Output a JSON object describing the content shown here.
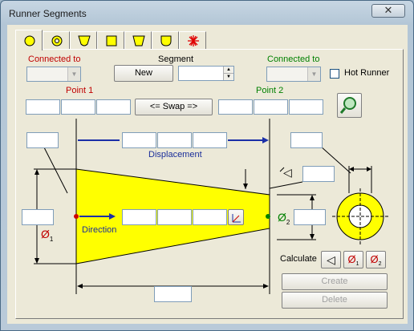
{
  "window": {
    "title": "Runner Segments",
    "close_glyph": "✕"
  },
  "tabs": [
    {
      "icon": "circle-section-icon"
    },
    {
      "icon": "annulus-section-icon"
    },
    {
      "icon": "trapezoid-rounded-section-icon"
    },
    {
      "icon": "square-section-icon"
    },
    {
      "icon": "trapezoid-section-icon"
    },
    {
      "icon": "half-round-section-icon"
    },
    {
      "icon": "custom-star-section-icon"
    }
  ],
  "connected_to_left": {
    "label": "Connected to",
    "value": ""
  },
  "segment": {
    "label": "Segment",
    "new_label": "New",
    "value": ""
  },
  "connected_to_right": {
    "label": "Connected to",
    "value": ""
  },
  "hot_runner": {
    "label": "Hot Runner",
    "checked": false
  },
  "point1": {
    "label": "Point 1",
    "values": [
      "",
      "",
      ""
    ]
  },
  "swap": {
    "label": "<= Swap =>"
  },
  "point2": {
    "label": "Point 2",
    "values": [
      "",
      "",
      ""
    ]
  },
  "diagram": {
    "displacement_label": "Displacement",
    "direction_label": "Direction",
    "d1_label": "Ø",
    "d1_sub": "1",
    "d2_label": "Ø",
    "d2_sub": "2",
    "colors": {
      "body": "#ffff00",
      "arrow": "#1b2fa8",
      "point1": "#cc0000",
      "point2": "#008000"
    }
  },
  "calculate": {
    "label": "Calculate",
    "taper_sym": "◁",
    "d1_sym": "Ø",
    "d1_sub": "1",
    "d2_sym": "Ø",
    "d2_sub": "2"
  },
  "create_label": "Create",
  "delete_label": "Delete"
}
